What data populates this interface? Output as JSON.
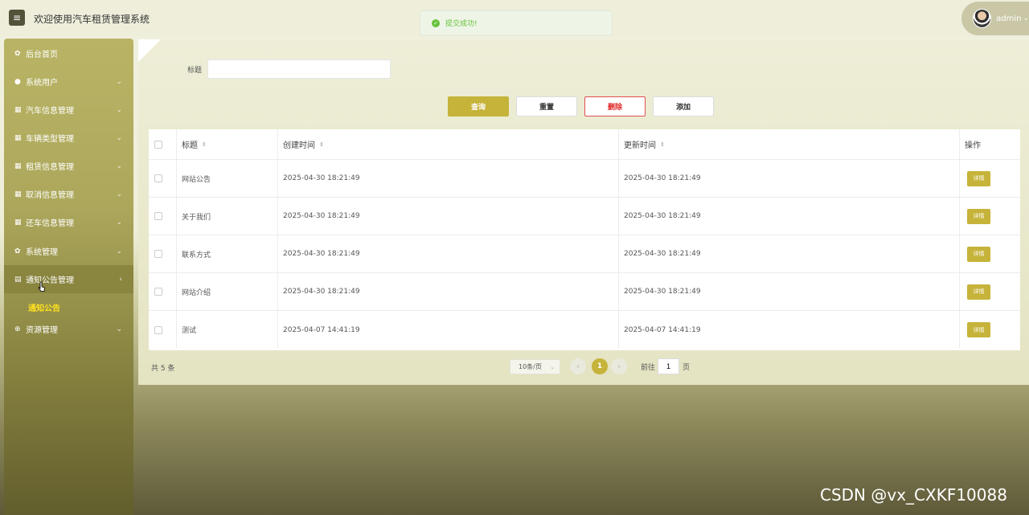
{
  "header": {
    "title": "欢迎使用汽车租赁管理系统",
    "menu_icon": "hamburger-icon",
    "user_name": "admin",
    "user_caret": "⌄"
  },
  "toast": {
    "message": "提交成功!",
    "icon": "check-circle-icon",
    "color": "#67c23a"
  },
  "sidebar": {
    "items": [
      {
        "label": "后台首页",
        "icon": "gear-icon",
        "has_chevron": false
      },
      {
        "label": "系统用户",
        "icon": "user-icon",
        "has_chevron": true
      },
      {
        "label": "汽车信息管理",
        "icon": "grid-icon",
        "has_chevron": true
      },
      {
        "label": "车辆类型管理",
        "icon": "grid-icon",
        "has_chevron": true
      },
      {
        "label": "租赁信息管理",
        "icon": "grid-icon",
        "has_chevron": true
      },
      {
        "label": "取消信息管理",
        "icon": "grid-icon",
        "has_chevron": true
      },
      {
        "label": "还车信息管理",
        "icon": "grid-icon",
        "has_chevron": true
      },
      {
        "label": "系统管理",
        "icon": "gear-icon",
        "has_chevron": true
      },
      {
        "label": "通知公告管理",
        "icon": "document-icon",
        "has_chevron": true,
        "active": true
      },
      {
        "label": "资源管理",
        "icon": "plus-circle-icon",
        "has_chevron": true
      }
    ],
    "sub_item": "通知公告"
  },
  "search": {
    "label": "标题",
    "value": "",
    "placeholder": ""
  },
  "buttons": {
    "query": "查询",
    "reset": "重置",
    "delete": "删除",
    "add": "添加"
  },
  "table": {
    "columns": [
      "标题",
      "创建时间",
      "更新时间",
      "操作"
    ],
    "rows": [
      {
        "title": "网站公告",
        "created": "2025-04-30 18:21:49",
        "updated": "2025-04-30 18:21:49",
        "action": "详情"
      },
      {
        "title": "关于我们",
        "created": "2025-04-30 18:21:49",
        "updated": "2025-04-30 18:21:49",
        "action": "详情"
      },
      {
        "title": "联系方式",
        "created": "2025-04-30 18:21:49",
        "updated": "2025-04-30 18:21:49",
        "action": "详情"
      },
      {
        "title": "网站介绍",
        "created": "2025-04-30 18:21:49",
        "updated": "2025-04-30 18:21:49",
        "action": "详情"
      },
      {
        "title": "测试",
        "created": "2025-04-07 14:41:19",
        "updated": "2025-04-07 14:41:19",
        "action": "详情"
      }
    ]
  },
  "pagination": {
    "total": "共 5 条",
    "page_size": "10条/页",
    "current_page": "1",
    "goto_label": "前往",
    "goto_value": "1",
    "page_unit": "页"
  },
  "watermark": "CSDN @vx_CXKF10088",
  "colors": {
    "accent": "#c6b33a",
    "sidebar": "#aca75b",
    "danger": "#e02020"
  }
}
